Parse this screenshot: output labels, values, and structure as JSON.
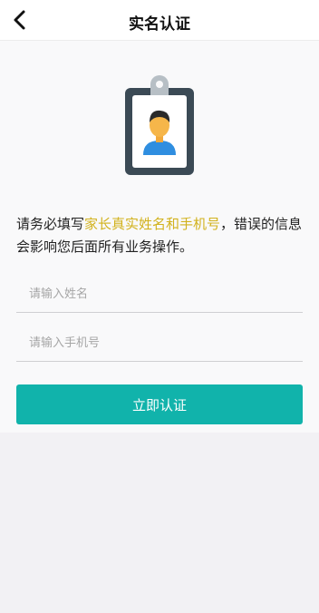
{
  "header": {
    "title": "实名认证"
  },
  "notice": {
    "prefix": "请务必填写",
    "highlight": "家长真实姓名和手机号",
    "suffix": "，错误的信息会影响您后面所有业务操作。"
  },
  "form": {
    "name_placeholder": "请输入姓名",
    "name_value": "",
    "phone_placeholder": "请输入手机号",
    "phone_value": ""
  },
  "submit": {
    "label": "立即认证"
  },
  "colors": {
    "accent": "#11b3ab",
    "highlight_text": "#d2b21d",
    "header_bg": "#ffffff",
    "content_bg": "#f9f9fa",
    "page_bg": "#f2f1f4"
  },
  "icons": {
    "back": "chevron-left-icon",
    "illustration": "id-badge-icon"
  }
}
